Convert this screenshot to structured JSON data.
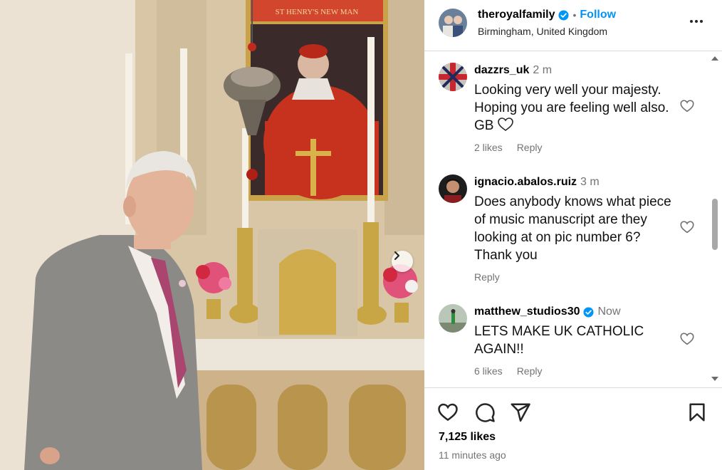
{
  "post": {
    "username": "theroyalfamily",
    "follow_label": "Follow",
    "separator": "•",
    "location": "Birmingham, United Kingdom",
    "likes": "7,125 likes",
    "posted": "11 minutes ago"
  },
  "photo_overlay": {
    "sign_text": "ST HENRY'S NEW MAN"
  },
  "comments": [
    {
      "username": "dazzrs_uk",
      "time": "2 m",
      "verified": false,
      "text": "Looking very well your majesty. Hoping you are feeling well also. GB",
      "likes": "2 likes",
      "reply": "Reply"
    },
    {
      "username": "ignacio.abalos.ruiz",
      "time": "3 m",
      "verified": false,
      "text": "Does anybody knows what piece of music manuscript are they looking at on pic number 6? Thank you",
      "likes": "",
      "reply": "Reply"
    },
    {
      "username": "matthew_studios30",
      "time": "Now",
      "verified": true,
      "text": "LETS MAKE UK CATHOLIC AGAIN!!",
      "likes": "6 likes",
      "reply": "Reply"
    }
  ],
  "icons": {
    "header": [
      "verified-badge-icon",
      "more-options-icon"
    ],
    "actions": [
      "heart-icon",
      "comment-icon",
      "share-icon",
      "bookmark-icon"
    ],
    "nav": [
      "chevron-right-icon"
    ]
  },
  "colors": {
    "link": "#0095f6",
    "muted": "#737373",
    "verified": "#0095f6",
    "border": "#dbdbdb"
  }
}
